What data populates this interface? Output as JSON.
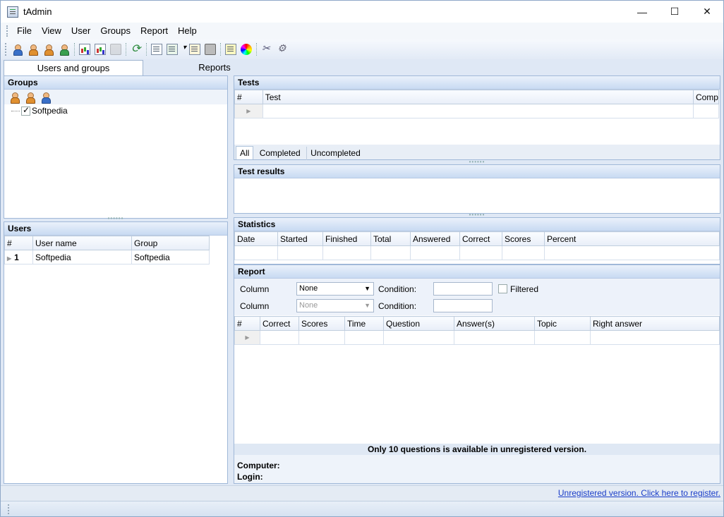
{
  "window": {
    "title": "tAdmin",
    "minimize": "—",
    "maximize": "☐",
    "close": "✕"
  },
  "menu": [
    "File",
    "View",
    "User",
    "Groups",
    "Report",
    "Help"
  ],
  "toolbar": {
    "icons": [
      "user-add-icon",
      "user-edit-icon",
      "user-key-icon",
      "user-import-icon",
      "chart-delete-icon",
      "chart-import-icon",
      "print-disabled-icon",
      "refresh-icon",
      "document-icon",
      "export-icon",
      "edit-icon",
      "print-icon",
      "palette-icon",
      "tools-icon",
      "gear-icon"
    ]
  },
  "tabs": {
    "users_groups": "Users and groups",
    "reports": "Reports"
  },
  "groups": {
    "header": "Groups",
    "tree_item": "Softpedia"
  },
  "users": {
    "header": "Users",
    "columns": [
      "#",
      "User name",
      "Group"
    ],
    "rows": [
      {
        "num": "1",
        "name": "Softpedia",
        "group": "Softpedia"
      }
    ]
  },
  "tests": {
    "header": "Tests",
    "columns": [
      "#",
      "Test",
      "Comp"
    ],
    "subtabs": [
      "All",
      "Completed",
      "Uncompleted"
    ]
  },
  "test_results": {
    "header": "Test results"
  },
  "statistics": {
    "header": "Statistics",
    "columns": [
      "Date",
      "Started",
      "Finished",
      "Total",
      "Answered",
      "Correct",
      "Scores",
      "Percent"
    ]
  },
  "report": {
    "header": "Report",
    "column_label": "Column",
    "condition_label": "Condition:",
    "select1": "None",
    "select2": "None",
    "filtered": "Filtered",
    "columns": [
      "#",
      "Correct",
      "Scores",
      "Time",
      "Question",
      "Answer(s)",
      "Topic",
      "Right answer"
    ],
    "notice": "Only 10 questions is available in unregistered version.",
    "computer_label": "Computer:",
    "login_label": "Login:"
  },
  "status": {
    "link": "Unregistered version. Click here to register."
  }
}
